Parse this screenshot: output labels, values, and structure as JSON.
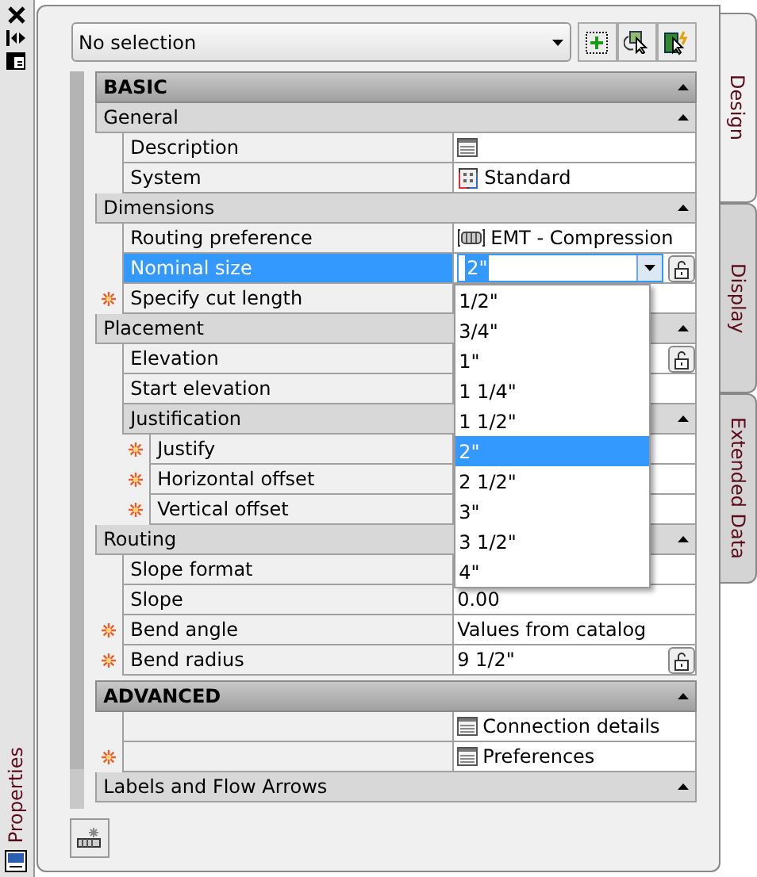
{
  "side_strip": {
    "label": "Properties"
  },
  "selector": {
    "value": "No selection"
  },
  "tabs": [
    {
      "label": "Design",
      "selected": true
    },
    {
      "label": "Display",
      "selected": false
    },
    {
      "label": "Extended Data",
      "selected": false
    }
  ],
  "sections": [
    {
      "title": "BASIC",
      "expanded": true,
      "groups": [
        {
          "title": "General",
          "expanded": true,
          "rows": [
            {
              "kind": "link",
              "label": "Description",
              "selected": false
            },
            {
              "kind": "system",
              "label": "System",
              "value": "Standard",
              "selected": false
            }
          ]
        },
        {
          "title": "Dimensions",
          "expanded": true,
          "rows": [
            {
              "kind": "routing",
              "label": "Routing preference",
              "value": "EMT - Compression",
              "selected": false
            },
            {
              "kind": "combo",
              "label": "Nominal size",
              "value": "2\"",
              "lock": true,
              "selected": true
            },
            {
              "kind": "property",
              "label": "Specify cut length",
              "required": true,
              "selected": false
            }
          ]
        },
        {
          "title": "Placement",
          "expanded": true,
          "rows": [
            {
              "kind": "property",
              "label": "Elevation",
              "lock": true,
              "selected": false
            },
            {
              "kind": "property",
              "label": "Start elevation",
              "selected": false
            },
            {
              "kind": "subgroup",
              "label": "Justification",
              "expanded": true,
              "rows": [
                {
                  "kind": "property",
                  "label": "Justify",
                  "required": true,
                  "selected": false
                },
                {
                  "kind": "property",
                  "label": "Horizontal offset",
                  "required": true,
                  "selected": false
                },
                {
                  "kind": "property",
                  "label": "Vertical offset",
                  "required": true,
                  "selected": false
                }
              ]
            }
          ]
        },
        {
          "title": "Routing",
          "expanded": true,
          "rows": [
            {
              "kind": "property",
              "label": "Slope format",
              "selected": false
            },
            {
              "kind": "property",
              "label": "Slope",
              "value": "0.00",
              "selected": false
            },
            {
              "kind": "property",
              "label": "Bend angle",
              "value": "Values from catalog",
              "required": true,
              "selected": false
            },
            {
              "kind": "property",
              "label": "Bend radius",
              "value": "9 1/2\"",
              "required": true,
              "lock": true,
              "selected": false
            }
          ]
        }
      ]
    },
    {
      "title": "ADVANCED",
      "expanded": true,
      "groups": [
        {
          "rows": [
            {
              "kind": "link",
              "value": "Connection details",
              "selected": false
            },
            {
              "kind": "link",
              "value": "Preferences",
              "required": true,
              "selected": false
            }
          ]
        },
        {
          "title": "Labels and Flow Arrows",
          "expanded": true
        }
      ]
    }
  ],
  "dropdown": {
    "options": [
      {
        "label": "1/2\"",
        "selected": false
      },
      {
        "label": "3/4\"",
        "selected": false
      },
      {
        "label": "1\"",
        "selected": false
      },
      {
        "label": "1 1/4\"",
        "selected": false
      },
      {
        "label": "1 1/2\"",
        "selected": false
      },
      {
        "label": "2\"",
        "selected": true
      },
      {
        "label": "2 1/2\"",
        "selected": false
      },
      {
        "label": "3\"",
        "selected": false
      },
      {
        "label": "3 1/2\"",
        "selected": false
      },
      {
        "label": "4\"",
        "selected": false
      }
    ]
  }
}
